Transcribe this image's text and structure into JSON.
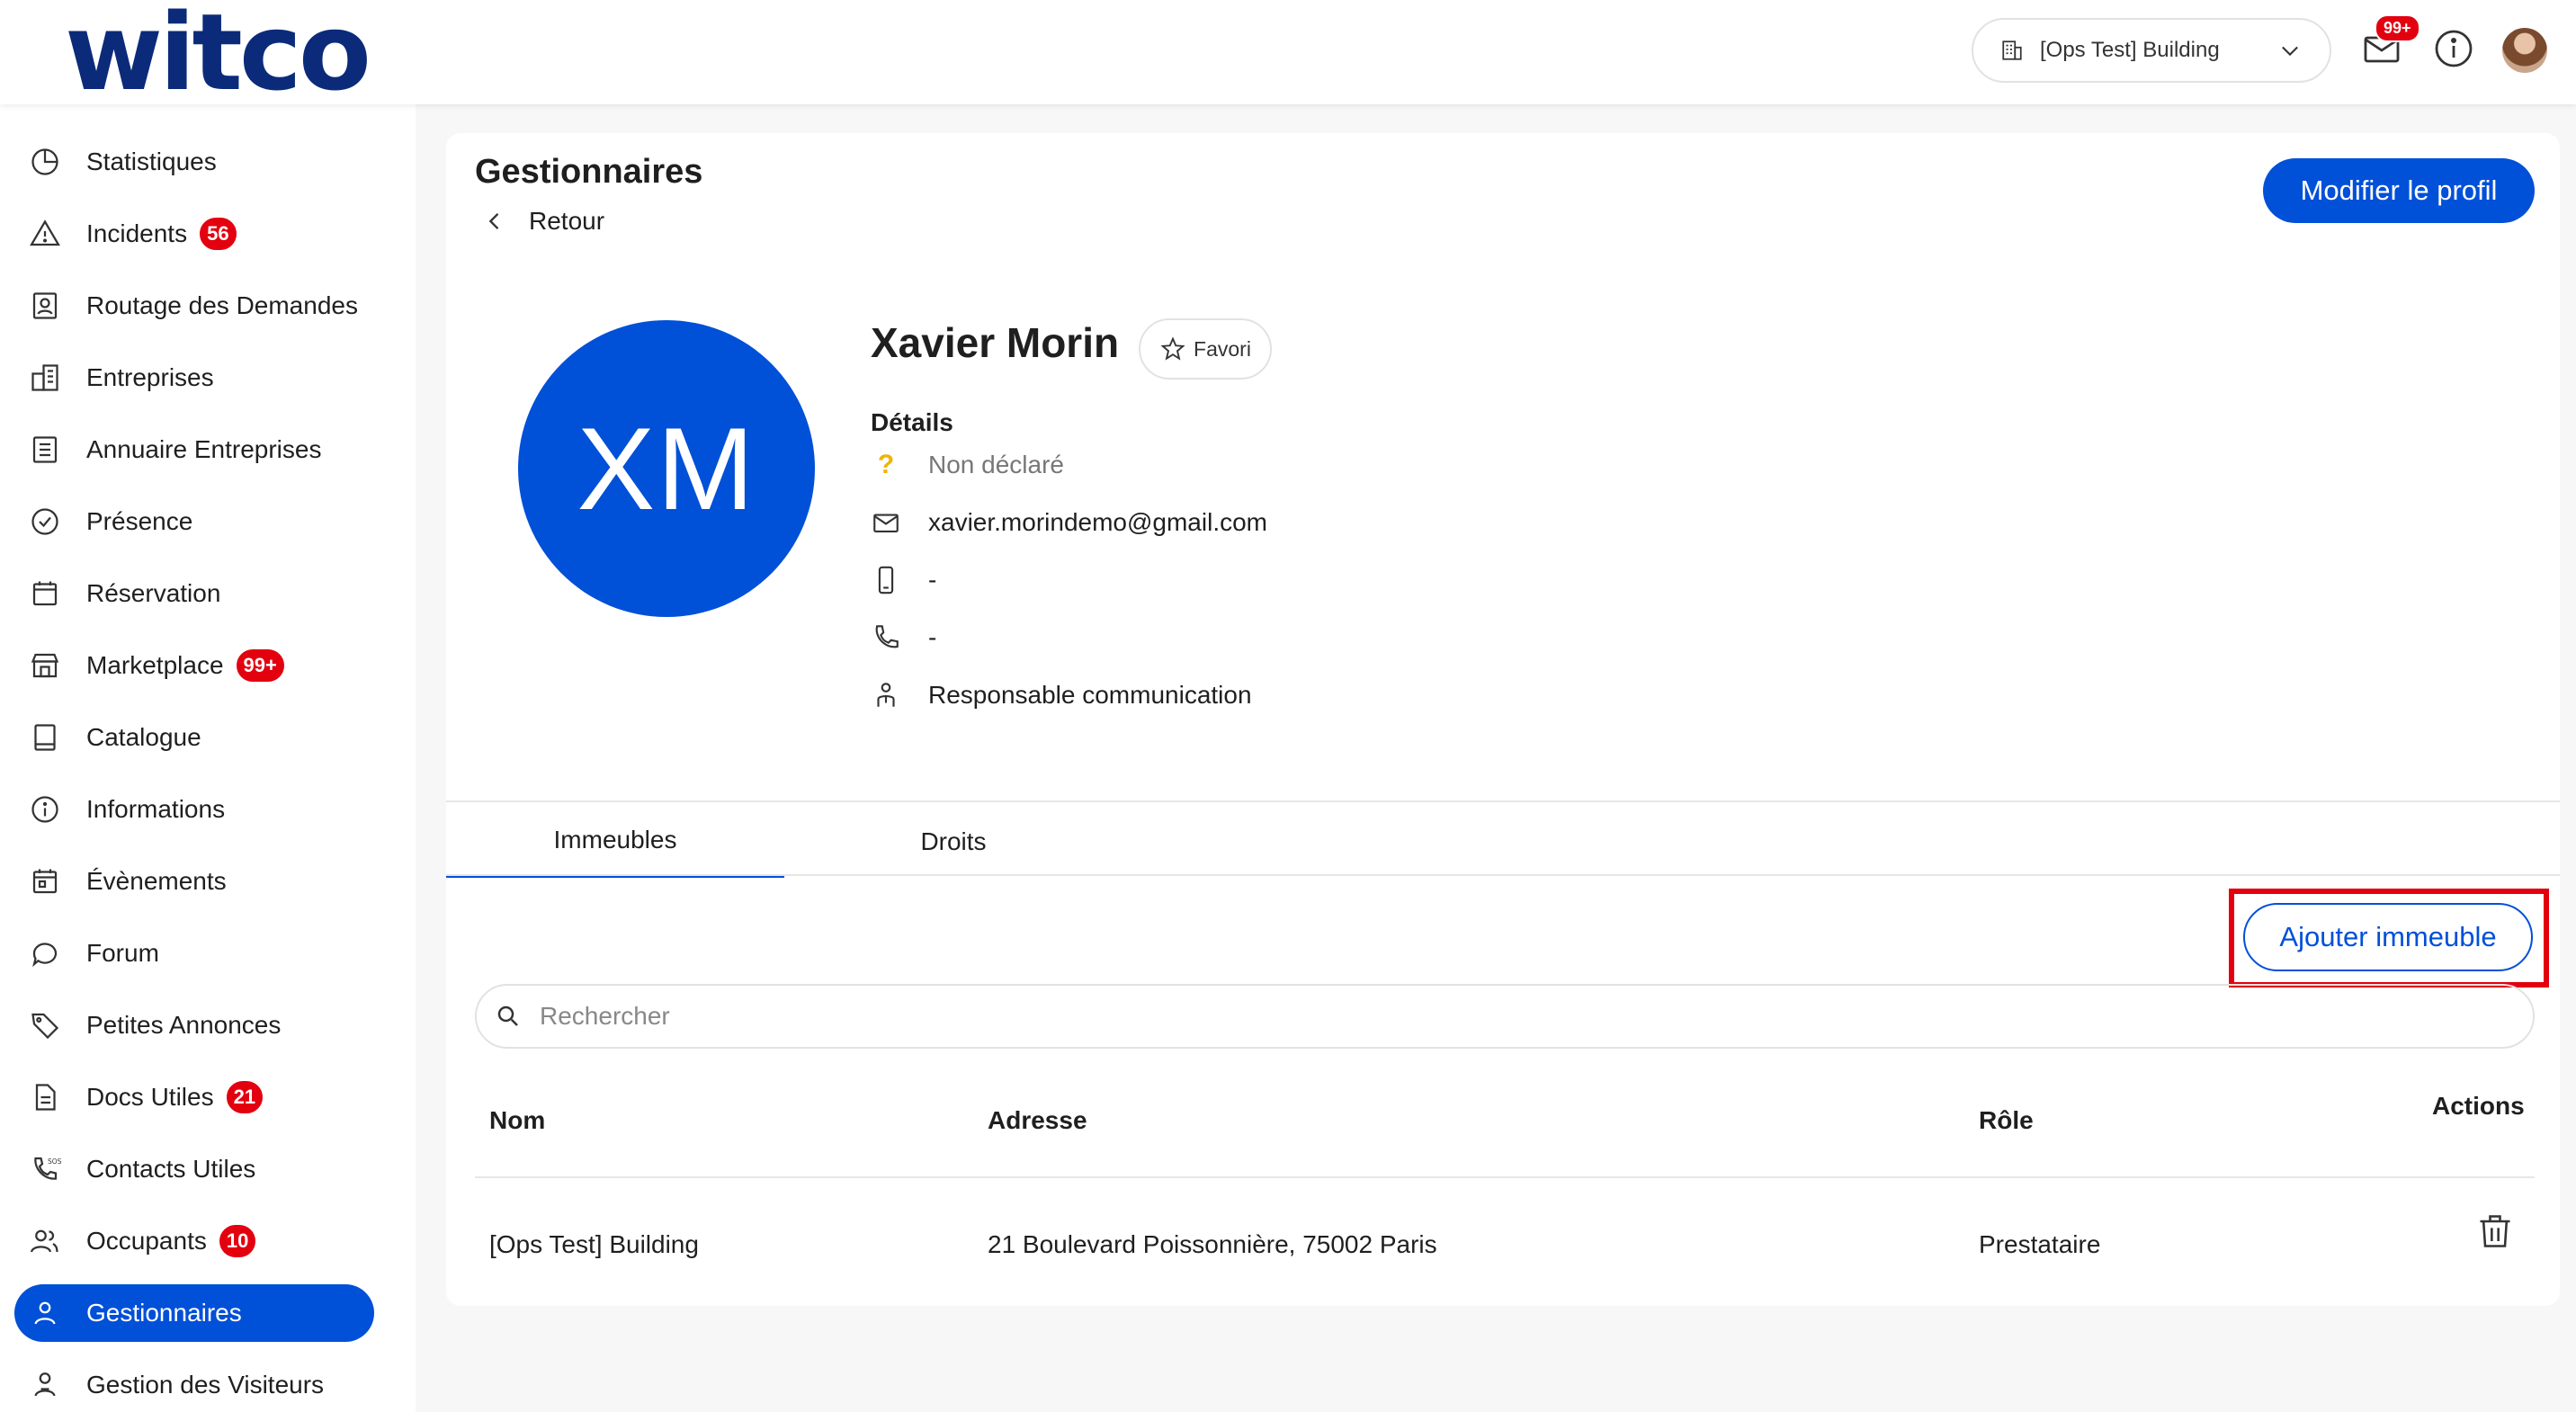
{
  "header": {
    "logo": "witco",
    "building_selector": "[Ops Test] Building",
    "notifications_badge": "99+"
  },
  "sidebar": {
    "items": [
      {
        "label": "Statistiques",
        "icon": "pie-chart-icon",
        "badge": ""
      },
      {
        "label": "Incidents",
        "icon": "warning-icon",
        "badge": "56"
      },
      {
        "label": "Routage des Demandes",
        "icon": "routing-icon",
        "badge": ""
      },
      {
        "label": "Entreprises",
        "icon": "buildings-icon",
        "badge": ""
      },
      {
        "label": "Annuaire Entreprises",
        "icon": "directory-icon",
        "badge": ""
      },
      {
        "label": "Présence",
        "icon": "check-circle-icon",
        "badge": ""
      },
      {
        "label": "Réservation",
        "icon": "calendar-icon",
        "badge": ""
      },
      {
        "label": "Marketplace",
        "icon": "store-icon",
        "badge": "99+"
      },
      {
        "label": "Catalogue",
        "icon": "book-icon",
        "badge": ""
      },
      {
        "label": "Informations",
        "icon": "info-icon",
        "badge": ""
      },
      {
        "label": "Évènements",
        "icon": "event-calendar-icon",
        "badge": ""
      },
      {
        "label": "Forum",
        "icon": "chat-icon",
        "badge": ""
      },
      {
        "label": "Petites Annonces",
        "icon": "tag-icon",
        "badge": ""
      },
      {
        "label": "Docs Utiles",
        "icon": "document-icon",
        "badge": "21"
      },
      {
        "label": "Contacts Utiles",
        "icon": "phone-sos-icon",
        "badge": ""
      },
      {
        "label": "Occupants",
        "icon": "users-icon",
        "badge": "10"
      },
      {
        "label": "Gestionnaires",
        "icon": "user-icon",
        "badge": "",
        "active": true
      },
      {
        "label": "Gestion des Visiteurs",
        "icon": "visitor-icon",
        "badge": ""
      }
    ]
  },
  "main": {
    "title": "Gestionnaires",
    "back_label": "Retour",
    "edit_profile_label": "Modifier le profil",
    "profile": {
      "initials": "XM",
      "name": "Xavier Morin",
      "favorite_label": "Favori",
      "details_title": "Détails",
      "status": "Non déclaré",
      "email": "xavier.morindemo@gmail.com",
      "mobile": "-",
      "phone": "-",
      "job_title": "Responsable communication"
    },
    "tabs": [
      {
        "label": "Immeubles",
        "active": true
      },
      {
        "label": "Droits",
        "active": false
      }
    ],
    "add_building_label": "Ajouter immeuble",
    "search_placeholder": "Rechercher",
    "table": {
      "headers": {
        "name": "Nom",
        "address": "Adresse",
        "role": "Rôle",
        "actions": "Actions"
      },
      "rows": [
        {
          "name": "[Ops Test] Building",
          "address": "21 Boulevard Poissonnière, 75002 Paris",
          "role": "Prestataire"
        }
      ]
    }
  },
  "colors": {
    "primary": "#0050d8",
    "logo": "#0b2b7a",
    "badge": "#e3000f",
    "highlight": "#e3000f"
  }
}
